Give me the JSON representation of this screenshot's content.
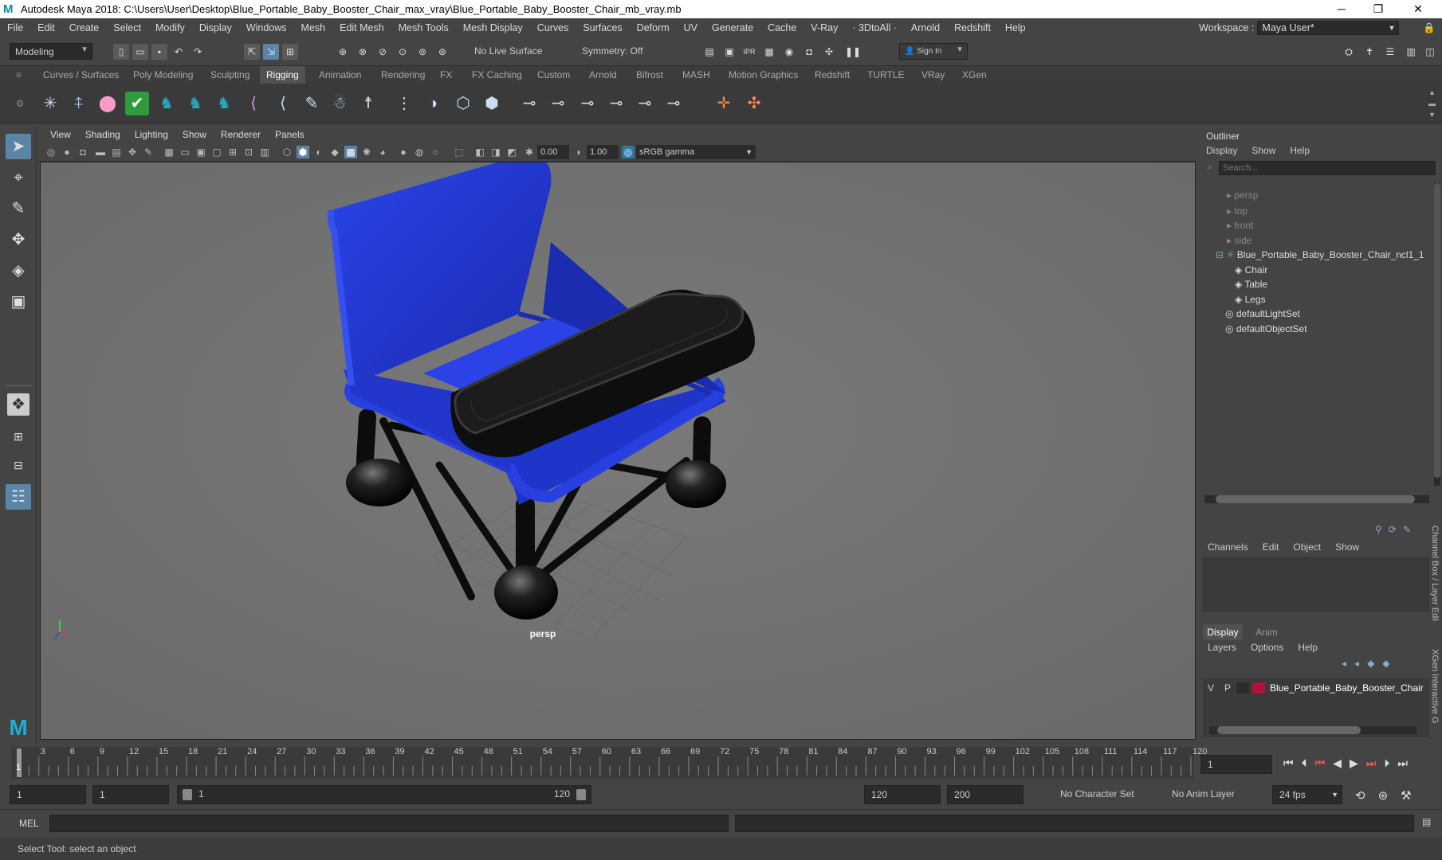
{
  "window": {
    "title": "Autodesk Maya 2018: C:\\Users\\User\\Desktop\\Blue_Portable_Baby_Booster_Chair_max_vray\\Blue_Portable_Baby_Booster_Chair_mb_vray.mb",
    "logo": "M"
  },
  "menu": [
    "File",
    "Edit",
    "Create",
    "Select",
    "Modify",
    "Display",
    "Windows",
    "Mesh",
    "Edit Mesh",
    "Mesh Tools",
    "Mesh Display",
    "Curves",
    "Surfaces",
    "Deform",
    "UV",
    "Generate",
    "Cache",
    "V-Ray",
    "· 3DtoAll ·",
    "Arnold",
    "Redshift",
    "Help"
  ],
  "workspace": {
    "label": "Workspace :",
    "value": "Maya User*"
  },
  "status": {
    "mode": "Modeling",
    "live_surface": "No Live Surface",
    "symmetry": "Symmetry: Off",
    "sign_in": "Sign In"
  },
  "shelf_tabs": [
    "Curves / Surfaces",
    "Poly Modeling",
    "Sculpting",
    "Rigging",
    "Animation",
    "Rendering",
    "FX",
    "FX Caching",
    "Custom",
    "Arnold",
    "Bifrost",
    "MASH",
    "Motion Graphics",
    "Redshift",
    "TURTLE",
    "VRay",
    "XGen"
  ],
  "shelf_active": "Rigging",
  "viewport": {
    "menu": [
      "View",
      "Shading",
      "Lighting",
      "Show",
      "Renderer",
      "Panels"
    ],
    "exposure": "0.00",
    "gamma": "1.00",
    "colorspace": "sRGB gamma",
    "camera_label": "persp"
  },
  "outliner": {
    "title": "Outliner",
    "menu": [
      "Display",
      "Show",
      "Help"
    ],
    "search_placeholder": "Search...",
    "cameras": [
      "persp",
      "top",
      "front",
      "side"
    ],
    "root": "Blue_Portable_Baby_Booster_Chair_ncl1_1",
    "children": [
      "Chair",
      "Table",
      "Legs"
    ],
    "sets": [
      "defaultLightSet",
      "defaultObjectSet"
    ]
  },
  "channelbox": {
    "menu": [
      "Channels",
      "Edit",
      "Object",
      "Show"
    ],
    "side_label": "Channel Box / Layer Editor"
  },
  "layers": {
    "tabs": [
      "Display",
      "Anim"
    ],
    "menu": [
      "Layers",
      "Options",
      "Help"
    ],
    "layer": {
      "v": "V",
      "p": "P",
      "name": "Blue_Portable_Baby_Booster_Chair",
      "color": "#b0143c"
    },
    "side_label": "XGen Interactive G"
  },
  "timeline": {
    "ticks": [
      "3",
      "6",
      "9",
      "12",
      "15",
      "18",
      "21",
      "24",
      "27",
      "30",
      "33",
      "36",
      "39",
      "42",
      "45",
      "48",
      "51",
      "54",
      "57",
      "60",
      "63",
      "66",
      "69",
      "72",
      "75",
      "78",
      "81",
      "84",
      "87",
      "90",
      "93",
      "96",
      "99",
      "102",
      "105",
      "108",
      "111",
      "114",
      "117",
      "120"
    ],
    "current_frame_label": "1",
    "current_frame": "1"
  },
  "range": {
    "start": "1",
    "playback_start": "1",
    "slider_start": "1",
    "slider_end": "120",
    "playback_end": "120",
    "end": "200",
    "character_set": "No Character Set",
    "anim_layer": "No Anim Layer",
    "fps": "24 fps"
  },
  "mel": {
    "label": "MEL"
  },
  "help_line": "Select Tool: select an object"
}
